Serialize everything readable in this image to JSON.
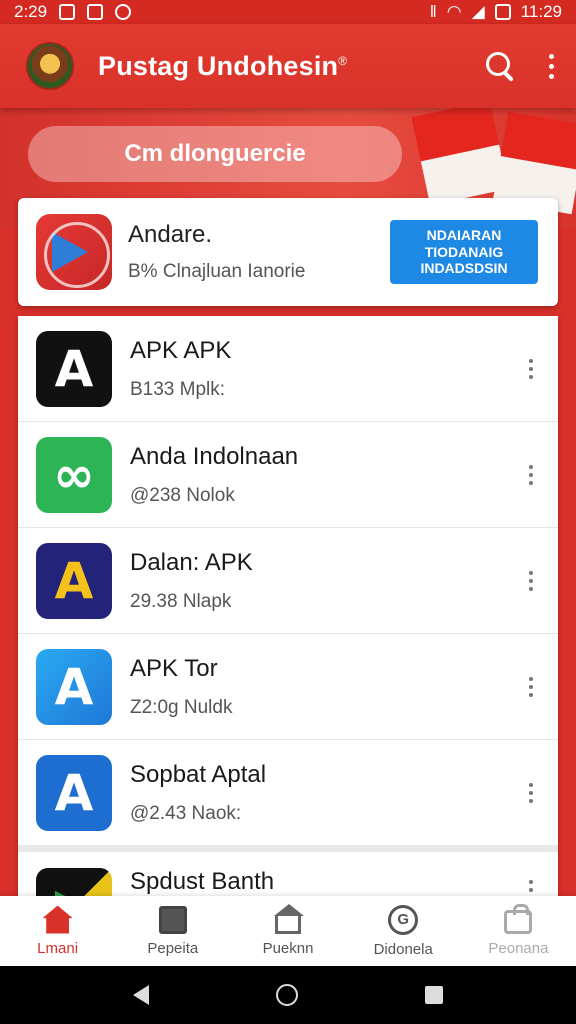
{
  "status_bar": {
    "time_left": "2:29",
    "time_right": "11:29"
  },
  "app_bar": {
    "title": "Pustag Undohesin",
    "title_mark": "®"
  },
  "hero": {
    "pill_text": "Cm dlonguercie"
  },
  "featured": {
    "name": "Andare.",
    "subtitle": "B% Clnajluan Ianorie",
    "badge_line1": "NDAIARAN",
    "badge_line2": "TIODANAIG",
    "badge_line3": "INDADSDSIN"
  },
  "apps": [
    {
      "name": "APK APK",
      "meta": "B133 Mplk:",
      "icon": "A"
    },
    {
      "name": "Anda Indolnaan",
      "meta": "@238 Nolok",
      "icon": "∞"
    },
    {
      "name": "Dalan: APK",
      "meta": "29.38 Nlapk",
      "icon": "A"
    },
    {
      "name": "APK Tor",
      "meta": "Z2:0g Nuldk",
      "icon": "A"
    },
    {
      "name": "Sopbat Aptal",
      "meta": "@2.43 Naok:",
      "icon": "A"
    },
    {
      "name": "Spdust Banth",
      "meta": "",
      "icon": "▶"
    }
  ],
  "bottom_nav": [
    {
      "label": "Lmani",
      "icon": "home-icon",
      "state": "active"
    },
    {
      "label": "Pepeita",
      "icon": "document-icon",
      "state": "normal"
    },
    {
      "label": "Pueknn",
      "icon": "house-icon",
      "state": "normal"
    },
    {
      "label": "Didonela",
      "icon": "g-icon",
      "state": "normal"
    },
    {
      "label": "Peonana",
      "icon": "bag-icon",
      "state": "disabled"
    }
  ],
  "colors": {
    "primary": "#d8322a",
    "badge": "#1e88e5"
  }
}
